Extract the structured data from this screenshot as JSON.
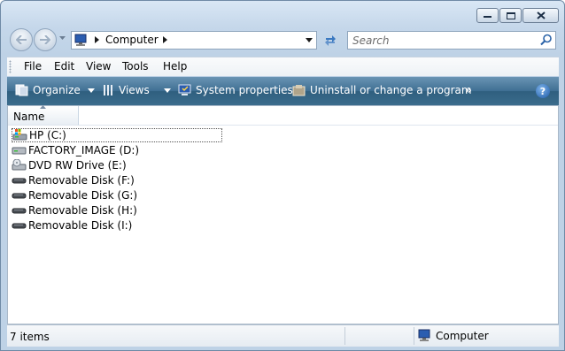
{
  "window": {
    "caption_buttons": [
      "minimize-icon",
      "maximize-icon",
      "close-icon"
    ]
  },
  "address": {
    "crumbs": [
      "Computer"
    ],
    "icon": "computer-icon"
  },
  "search": {
    "placeholder": "Search"
  },
  "menu": {
    "items": [
      "File",
      "Edit",
      "View",
      "Tools",
      "Help"
    ]
  },
  "commands": {
    "organize": "Organize",
    "views": "Views",
    "system_properties": "System properties",
    "uninstall": "Uninstall or change a program",
    "more": "»",
    "help": "?"
  },
  "columns": {
    "name": "Name"
  },
  "drives": [
    {
      "label": "HP (C:)",
      "icon": "hard-disk-windows-icon",
      "selected": true
    },
    {
      "label": "FACTORY_IMAGE (D:)",
      "icon": "hard-disk-icon"
    },
    {
      "label": "DVD RW Drive (E:)",
      "icon": "dvd-drive-icon"
    },
    {
      "label": "Removable Disk (F:)",
      "icon": "removable-disk-icon"
    },
    {
      "label": "Removable Disk (G:)",
      "icon": "removable-disk-icon"
    },
    {
      "label": "Removable Disk (H:)",
      "icon": "removable-disk-icon"
    },
    {
      "label": "Removable Disk (I:)",
      "icon": "removable-disk-icon"
    }
  ],
  "status": {
    "count": "7 items",
    "location": "Computer"
  },
  "colors": {
    "command_bar": "#3f6f93",
    "window_frame": "#c5d7ea"
  }
}
